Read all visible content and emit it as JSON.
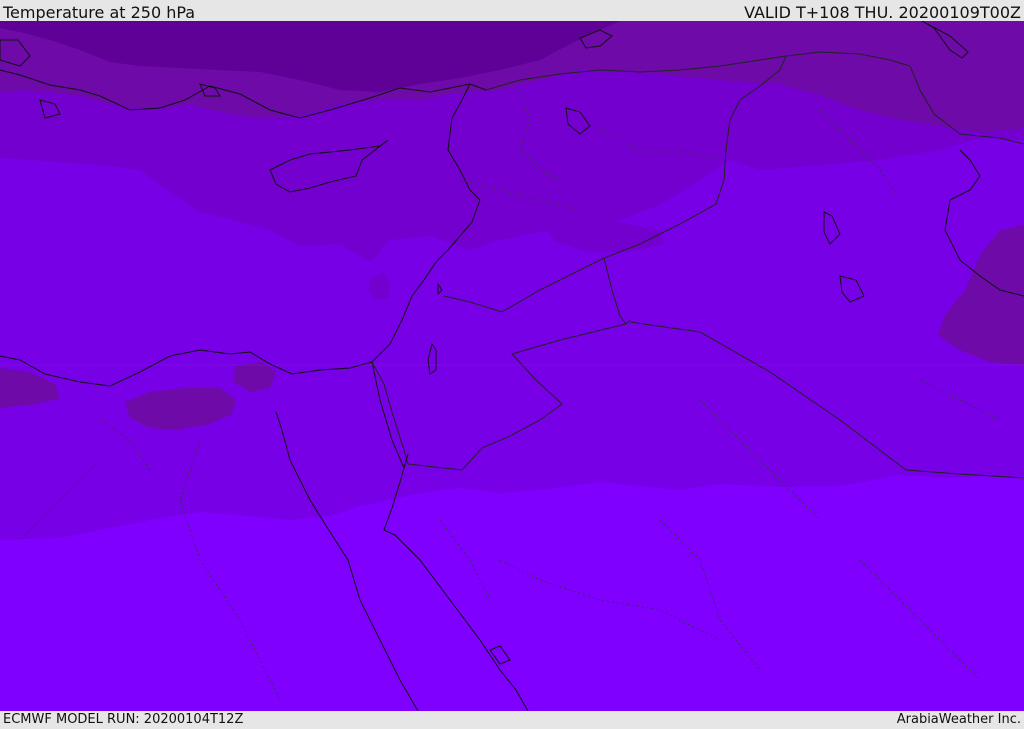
{
  "header": {
    "title": "Temperature at 250 hPa",
    "valid_time": "VALID T+108 THU. 20200109T00Z"
  },
  "footer": {
    "model_run": "ECMWF MODEL RUN: 20200104T12Z",
    "credit": "ArabiaWeather Inc."
  },
  "map": {
    "field": "Temperature at 250 hPa",
    "colors": {
      "band_coldest": "#5f0096",
      "band_cold": "#6f0aa8",
      "band_mid": "#7700c6",
      "band_mid2": "#7a00d8",
      "band_warm": "#7c00f0",
      "band_warmest": "#7f00ff",
      "coastline": "#111111",
      "border": "#222222"
    }
  }
}
